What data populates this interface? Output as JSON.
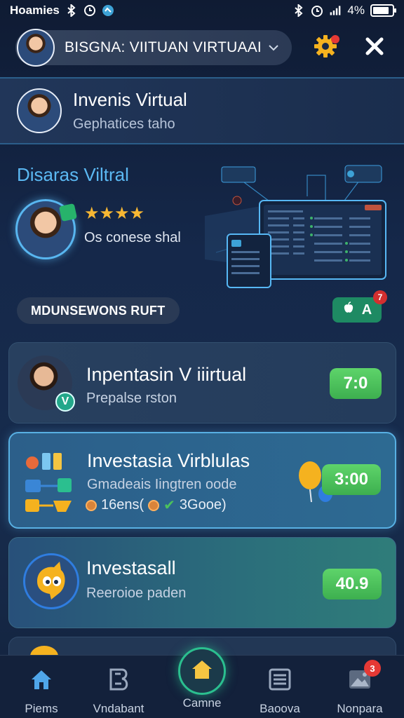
{
  "status_bar": {
    "carrier": "Hoamies",
    "battery": "4%"
  },
  "header": {
    "profile_name": "BISGNA: VIITUAN VIRTUAAI",
    "icons": [
      "chevron-down-icon",
      "gear-icon",
      "close-icon"
    ]
  },
  "profile_card": {
    "title": "Invenis Virtual",
    "subtitle": "Gephatices taho"
  },
  "hero": {
    "title": "Disaras Viltral",
    "stars": "★★★★",
    "caption": "Os conese shal",
    "pill_label": "MDUNSEWONS RUFT",
    "action_label": "A",
    "action_badge": "7"
  },
  "cards": [
    {
      "title": "Inpentasin V iiirtual",
      "subtitle": "Prepalse rston",
      "amount": "7:0",
      "badge": "V"
    },
    {
      "title": "Investasia Virblulas",
      "subtitle": "Gmadeais Iingtren oode",
      "meta_left": "16ens(",
      "meta_right": "3Gooe)",
      "amount": "3:00"
    },
    {
      "title": "Investasall",
      "subtitle": "Reeroioe paden",
      "amount": "40.9"
    }
  ],
  "bottom_nav": {
    "items": [
      {
        "label": "Piems",
        "icon": "home-icon"
      },
      {
        "label": "Vndabant",
        "icon": "b-icon"
      },
      {
        "label": "Camne",
        "icon": "home-icon"
      },
      {
        "label": "Baoova",
        "icon": "list-icon"
      },
      {
        "label": "Nonpara",
        "icon": "image-icon",
        "badge": "3"
      }
    ]
  },
  "colors": {
    "accent": "#58b6f0",
    "success": "#4cc25c",
    "badge": "#e53935",
    "background": "#15284a"
  }
}
